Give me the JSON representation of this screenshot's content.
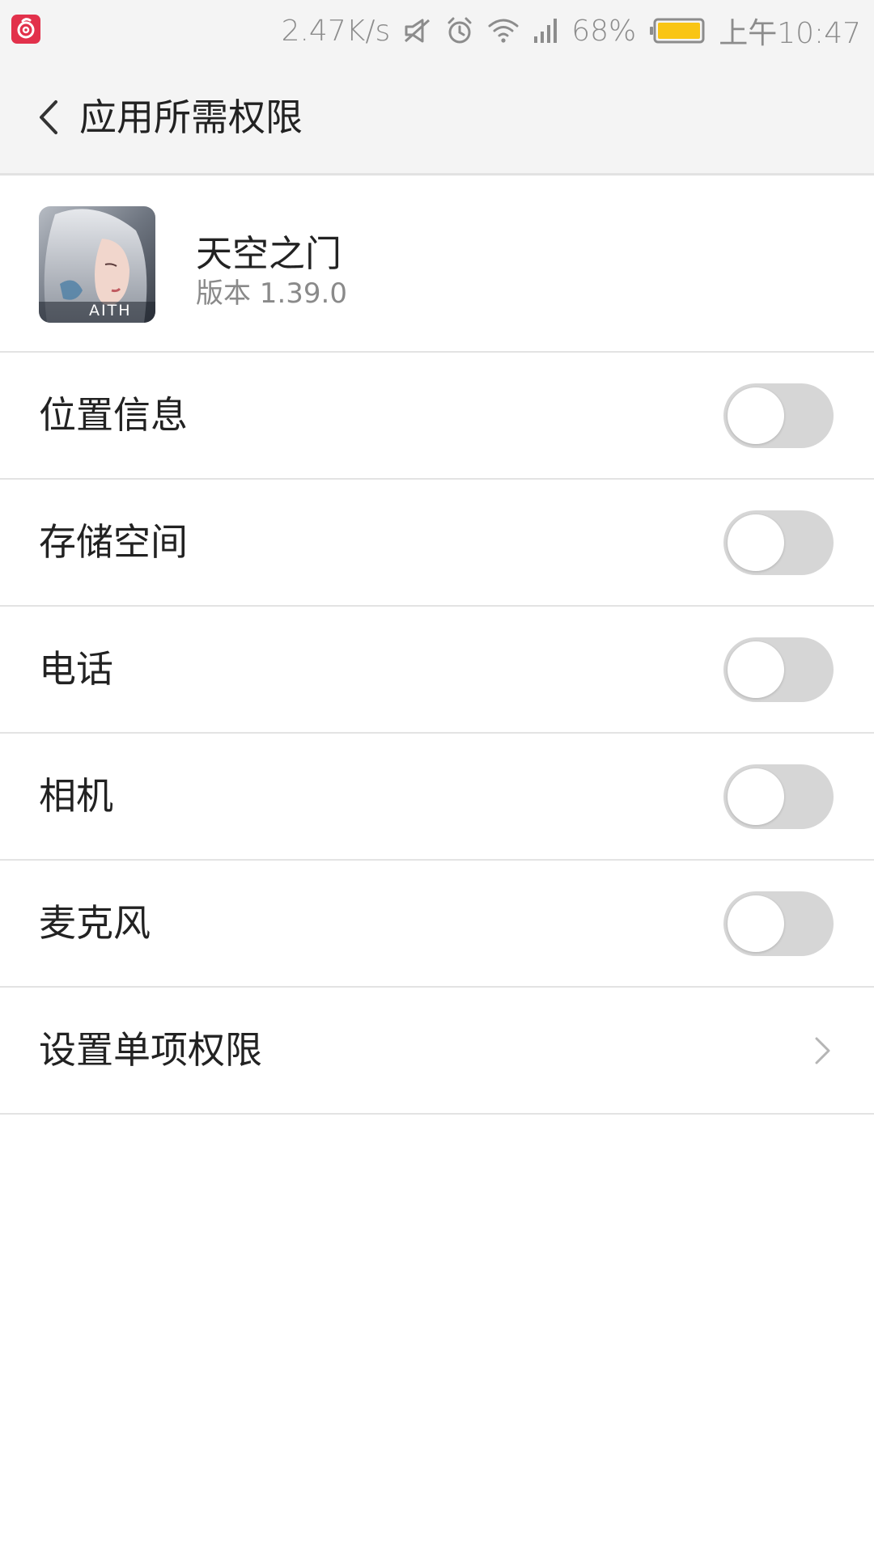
{
  "status_bar": {
    "app_icon": "netease-music-icon",
    "net_speed": "2.47K/s",
    "icons": [
      "mute-icon",
      "alarm-icon",
      "wifi-icon",
      "signal-icon"
    ],
    "battery_percent": "68%",
    "battery_level": 0.68,
    "time": "上午10:47"
  },
  "header": {
    "back_icon": "back-arrow-icon",
    "title": "应用所需权限"
  },
  "app": {
    "name": "天空之门",
    "version": "版本 1.39.0",
    "icon_text": "AITH"
  },
  "permissions": [
    {
      "label": "位置信息",
      "enabled": false
    },
    {
      "label": "存储空间",
      "enabled": false
    },
    {
      "label": "电话",
      "enabled": false
    },
    {
      "label": "相机",
      "enabled": false
    },
    {
      "label": "麦克风",
      "enabled": false
    }
  ],
  "single_permission": {
    "label": "设置单项权限",
    "icon": "chevron-right-icon"
  },
  "colors": {
    "background": "#ffffff",
    "header_bg": "#f4f4f4",
    "toggle_off": "#d6d6d6",
    "battery": "#f9c515",
    "app_icon_red": "#e2314b"
  }
}
